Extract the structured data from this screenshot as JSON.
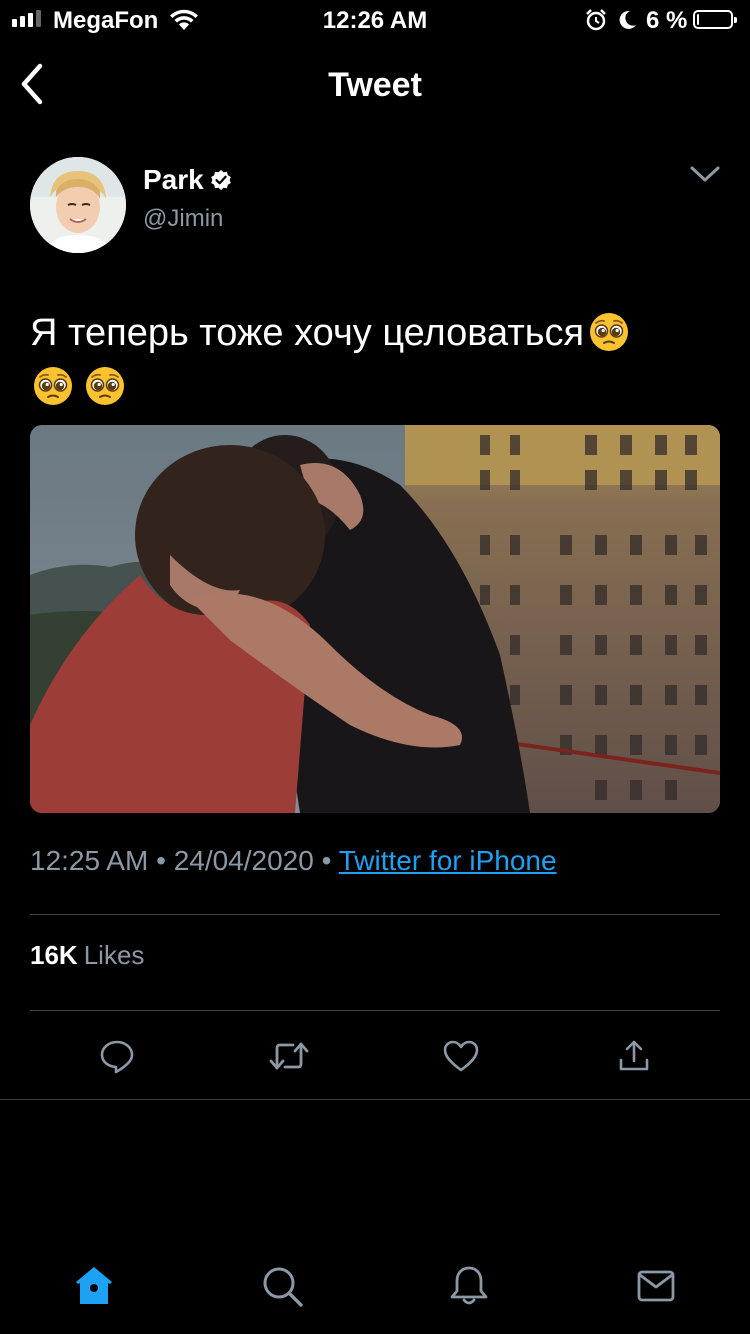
{
  "status_bar": {
    "carrier": "MegaFon",
    "time": "12:26 AM",
    "battery_percent": "6 %",
    "battery_level": 0.06
  },
  "header": {
    "title": "Tweet",
    "back_icon": "chevron-left-icon"
  },
  "tweet": {
    "author_name": "Park",
    "author_handle": "@Jimin",
    "verified": true,
    "text": "Я теперь тоже хочу целоваться",
    "emoji_name": "pleading-face-emoji",
    "timestamp_time": "12:25 AM",
    "separator": "•",
    "timestamp_date": "24/04/2020",
    "source": "Twitter for iPhone",
    "likes_count": "16K",
    "likes_label": "Likes"
  },
  "actions": [
    "reply-icon",
    "retweet-icon",
    "like-icon",
    "share-icon"
  ],
  "tab_bar": [
    "home-icon",
    "search-icon",
    "notifications-icon",
    "messages-icon"
  ],
  "colors": {
    "background": "#000000",
    "text": "#ffffff",
    "secondary_text": "#8b98a5",
    "accent": "#1da1f2",
    "divider": "#38444d"
  }
}
